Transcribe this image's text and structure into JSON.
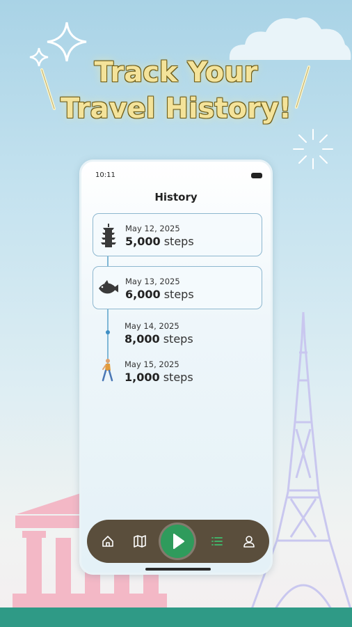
{
  "promo": {
    "headline_line1": "Track Your",
    "headline_line2": "Travel History!"
  },
  "status_bar": {
    "time": "10:11"
  },
  "history": {
    "title": "History",
    "entries": [
      {
        "date": "May 12, 2025",
        "steps_value": "5,000",
        "steps_unit": "steps",
        "icon": "pagoda-icon",
        "highlighted": true
      },
      {
        "date": "May 13, 2025",
        "steps_value": "6,000",
        "steps_unit": "steps",
        "icon": "fish-icon",
        "highlighted": true
      },
      {
        "date": "May 14, 2025",
        "steps_value": "8,000",
        "steps_unit": "steps",
        "icon": "timeline-dot",
        "highlighted": false
      },
      {
        "date": "May 15, 2025",
        "steps_value": "1,000",
        "steps_unit": "steps",
        "icon": "walker-icon",
        "highlighted": false
      }
    ]
  },
  "nav": {
    "items": [
      "home-icon",
      "map-icon",
      "play-icon",
      "list-icon",
      "profile-icon"
    ],
    "active": "list-icon"
  },
  "colors": {
    "accent_green": "#2f9b5c",
    "nav_bg": "#5a4e3c",
    "headline": "#f4e39a",
    "card_border": "#8db7cf"
  }
}
